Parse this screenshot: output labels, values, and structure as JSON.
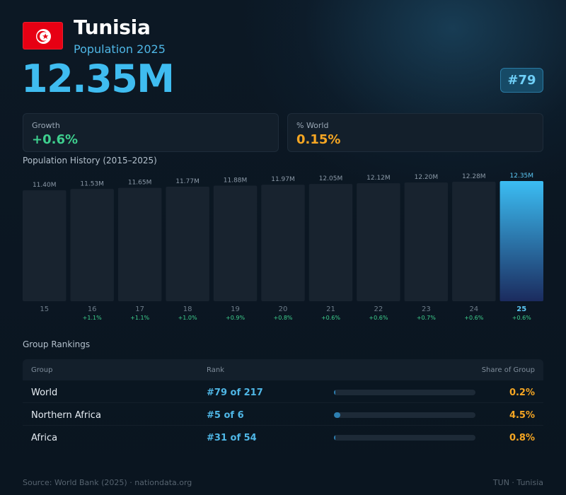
{
  "country": {
    "name": "Tunisia",
    "subtitle": "Population 2025",
    "population": "12.35M",
    "rank": "#79",
    "flag_colors": {
      "field": "#e70013",
      "disc": "#ffffff",
      "emblem": "#e70013"
    }
  },
  "stats": {
    "growth_label": "Growth",
    "growth_value": "+0.6%",
    "world_label": "% World",
    "world_value": "0.15%"
  },
  "history_title": "Population History (2015–2025)",
  "chart_data": {
    "type": "bar",
    "title": "Population History (2015–2025)",
    "categories": [
      "15",
      "16",
      "17",
      "18",
      "19",
      "20",
      "21",
      "22",
      "23",
      "24",
      "25"
    ],
    "values": [
      11.4,
      11.53,
      11.65,
      11.77,
      11.88,
      11.97,
      12.05,
      12.12,
      12.2,
      12.28,
      12.35
    ],
    "value_labels": [
      "11.40M",
      "11.53M",
      "11.65M",
      "11.77M",
      "11.88M",
      "11.97M",
      "12.05M",
      "12.12M",
      "12.20M",
      "12.28M",
      "12.35M"
    ],
    "growth_labels": [
      "",
      "+1.1%",
      "+1.1%",
      "+1.0%",
      "+0.9%",
      "+0.8%",
      "+0.6%",
      "+0.6%",
      "+0.7%",
      "+0.6%",
      "+0.6%"
    ],
    "highlight_index": 10,
    "ylim": [
      0,
      12.35
    ],
    "xlabel": "",
    "ylabel": "",
    "grid": false,
    "colors": {
      "bar": "#18232f",
      "highlight_top": "#3bbdf3",
      "highlight_bottom": "#1b2b5e",
      "growth": "#3ecf8e",
      "value_label": "#8c9aa8",
      "highlight_label": "#5cc8f5"
    }
  },
  "rankings": {
    "title": "Group Rankings",
    "headers": {
      "group": "Group",
      "rank": "Rank",
      "share": "Share of Group"
    },
    "rows": [
      {
        "group": "World",
        "rank": "#79 of 217",
        "share": "0.2%",
        "share_value": 0.2
      },
      {
        "group": "Northern Africa",
        "rank": "#5 of 6",
        "share": "4.5%",
        "share_value": 4.5
      },
      {
        "group": "Africa",
        "rank": "#31 of 54",
        "share": "0.8%",
        "share_value": 0.8
      }
    ]
  },
  "footer": {
    "source": "Source: World Bank (2025) · nationdata.org",
    "code": "TUN · Tunisia"
  }
}
